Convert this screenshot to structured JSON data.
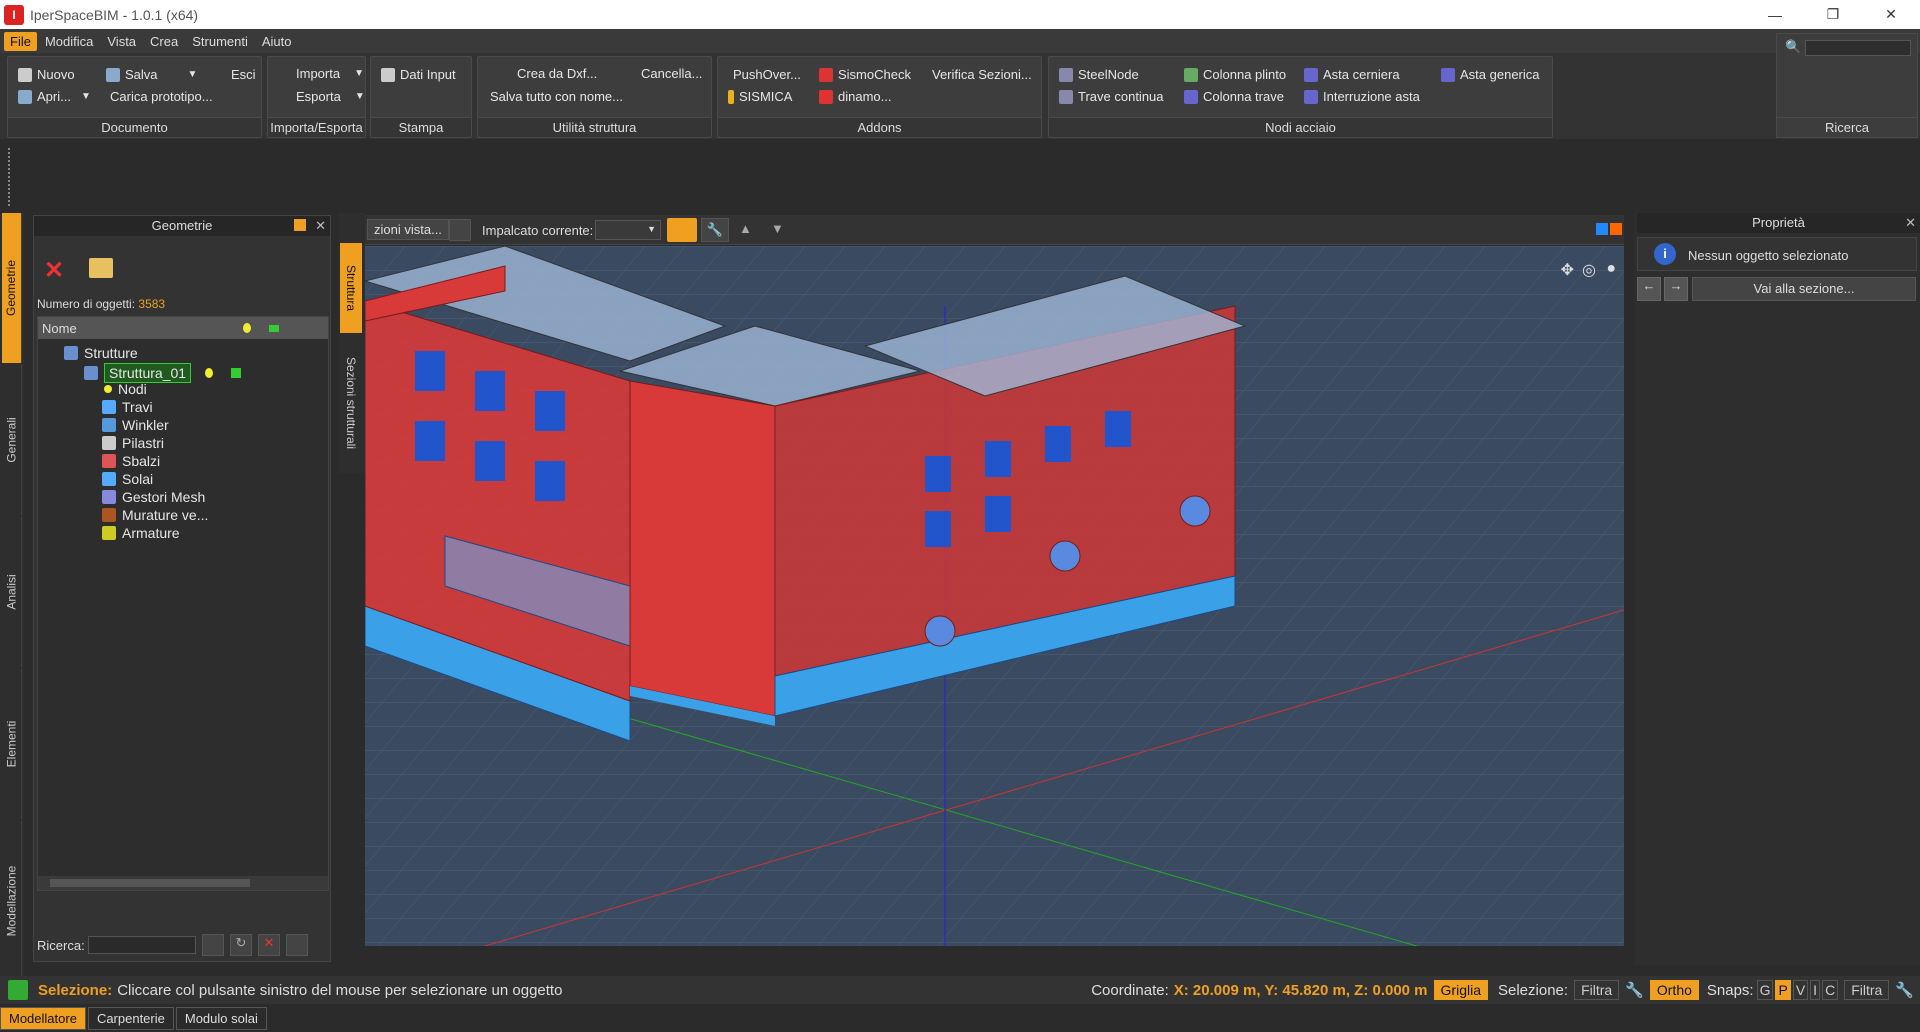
{
  "title": "IperSpaceBIM - 1.0.1 (x64)",
  "menu": [
    "File",
    "Modifica",
    "Vista",
    "Crea",
    "Strumenti",
    "Aiuto"
  ],
  "ribbon": {
    "documento": {
      "label": "Documento",
      "nuovo": "Nuovo",
      "salva": "Salva",
      "esci": "Esci",
      "apri": "Apri...",
      "carica": "Carica prototipo..."
    },
    "importa": {
      "label": "Importa/Esporta",
      "importa": "Importa",
      "esporta": "Esporta"
    },
    "stampa": {
      "label": "Stampa",
      "dati": "Dati Input"
    },
    "utilita": {
      "label": "Utilità struttura",
      "crea": "Crea da Dxf...",
      "cancella": "Cancella...",
      "salva": "Salva tutto con nome..."
    },
    "addons": {
      "label": "Addons",
      "push": "PushOver...",
      "sismo": "SismoCheck",
      "verifica": "Verifica Sezioni...",
      "sismica": "SISMICA",
      "dinamo": "dinamo..."
    },
    "nodi": {
      "label": "Nodi acciaio",
      "steel": "SteelNode",
      "plinto": "Colonna plinto",
      "cerniera": "Asta cerniera",
      "generica": "Asta generica",
      "trave": "Trave continua",
      "ctrave": "Colonna trave",
      "interruzione": "Interruzione asta"
    },
    "ricerca": {
      "label": "Ricerca"
    }
  },
  "lefttabs": [
    "Geometrie",
    "Generali",
    "Analisi",
    "Elementi",
    "Modellazione"
  ],
  "geometrie": {
    "title": "Geometrie",
    "count_label": "Numero di oggetti:",
    "count": "3583",
    "col_name": "Nome",
    "tree": [
      "Strutture",
      "Struttura_01",
      "Nodi",
      "Travi",
      "Winkler",
      "Pilastri",
      "Sbalzi",
      "Solai",
      "Gestori Mesh",
      "Murature ve...",
      "Armature"
    ],
    "search_label": "Ricerca:"
  },
  "viewtabs": [
    "Struttura",
    "Sezioni strutturali"
  ],
  "viewtoolbar": {
    "sezioni": "zioni vista...",
    "impalcato": "Impalcato corrente:"
  },
  "axis_z": "+Z",
  "properties": {
    "title": "Proprietà",
    "none": "Nessun oggetto selezionato",
    "goto": "Vai alla sezione..."
  },
  "status": {
    "sel_label": "Selezione:",
    "sel_msg": "Cliccare col pulsante sinistro del mouse per selezionare un oggetto",
    "coord_label": "Coordinate:",
    "coord": "X: 20.009 m, Y: 45.820 m, Z: 0.000 m",
    "griglia": "Griglia",
    "selezione2": "Selezione:",
    "filtra": "Filtra",
    "ortho": "Ortho",
    "snaps": "Snaps:",
    "snap_keys": [
      "G",
      "P",
      "V",
      "I",
      "C"
    ],
    "filtra2": "Filtra"
  },
  "bottomtabs": [
    "Modellatore",
    "Carpenterie",
    "Modulo solai"
  ]
}
